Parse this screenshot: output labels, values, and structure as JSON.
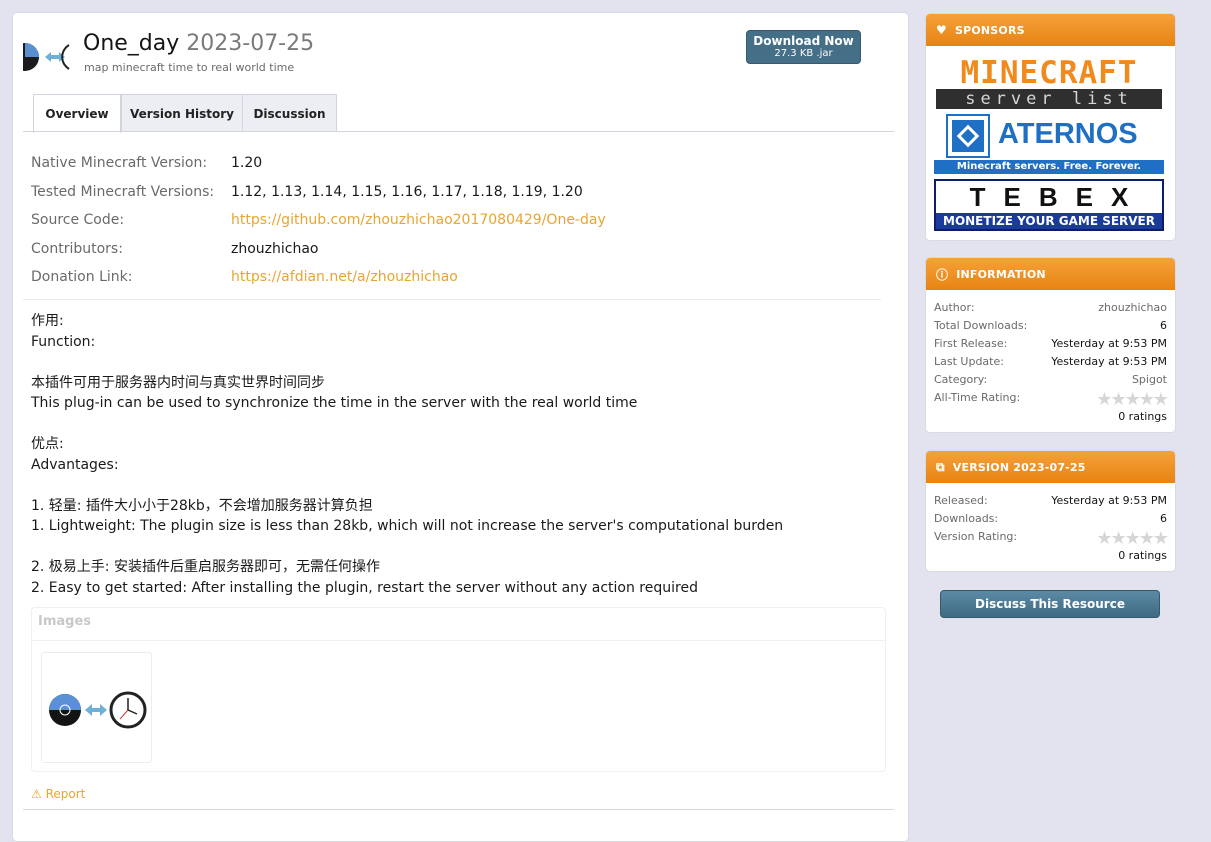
{
  "resource": {
    "name": "One_day",
    "version": "2023-07-25",
    "tagline": "map minecraft time to real world time"
  },
  "download": {
    "label": "Download Now",
    "size": "27.3 KB .jar"
  },
  "tabs": [
    {
      "label": "Overview",
      "active": true
    },
    {
      "label": "Version History",
      "active": false
    },
    {
      "label": "Discussion",
      "active": false
    }
  ],
  "fields": [
    {
      "label": "Native Minecraft Version:",
      "value": "1.20",
      "link": false
    },
    {
      "label": "Tested Minecraft Versions:",
      "value": "1.12, 1.13, 1.14, 1.15, 1.16, 1.17, 1.18, 1.19, 1.20",
      "link": false
    },
    {
      "label": "Source Code:",
      "value": "https://github.com/zhouzhichao2017080429/One-day",
      "link": true
    },
    {
      "label": "Contributors:",
      "value": "zhouzhichao",
      "link": false
    },
    {
      "label": "Donation Link:",
      "value": "https://afdian.net/a/zhouzhichao",
      "link": true
    }
  ],
  "description": {
    "l1": "作用:",
    "l2": "Function:",
    "l3": "本插件可用于服务器内时间与真实世界时间同步",
    "l4": "This plug-in can be used to synchronize the time in the server with the real world time",
    "l5": "优点:",
    "l6": "Advantages:",
    "l7": "1. 轻量:  插件大小小于28kb，不会增加服务器计算负担",
    "l8": "1. Lightweight: The plugin size is less than 28kb, which will not increase the server's computational burden",
    "l9": "2. 极易上手:  安装插件后重启服务器即可，无需任何操作",
    "l10": "2. Easy to get started: After installing the plugin, restart the server without any action required"
  },
  "images": {
    "title": "Images"
  },
  "report": {
    "label": "Report"
  },
  "sponsors": {
    "title": "SPONSORS",
    "minecraft_top": "MINECRAFT",
    "minecraft_bottom": "server list",
    "aternos_name": "ATERNOS",
    "aternos_tagline": "Minecraft servers. Free. Forever.",
    "tebex_name": "TEBEX",
    "tebex_tagline": "MONETIZE YOUR GAME SERVER"
  },
  "information": {
    "title": "INFORMATION",
    "author_label": "Author:",
    "author": "zhouzhichao",
    "downloads_label": "Total Downloads:",
    "downloads": "6",
    "first_label": "First Release:",
    "first": "Yesterday at 9:53 PM",
    "last_label": "Last Update:",
    "last": "Yesterday at 9:53 PM",
    "category_label": "Category:",
    "category": "Spigot",
    "rating_label": "All-Time Rating:",
    "rating_stars": 0,
    "ratings": "0 ratings"
  },
  "version_block": {
    "title": "VERSION 2023-07-25",
    "released_label": "Released:",
    "released": "Yesterday at 9:53 PM",
    "downloads_label": "Downloads:",
    "downloads": "6",
    "rating_label": "Version Rating:",
    "rating_stars": 0,
    "ratings": "0 ratings"
  },
  "discuss": {
    "label": "Discuss This Resource"
  },
  "colors": {
    "accent": "#e8a531",
    "header_orange": "#ef8f1d",
    "button_blue": "#456e87"
  },
  "icons": {
    "sponsors": "heart-icon",
    "information": "info-icon",
    "version": "copy-icon",
    "report": "warning-icon"
  }
}
